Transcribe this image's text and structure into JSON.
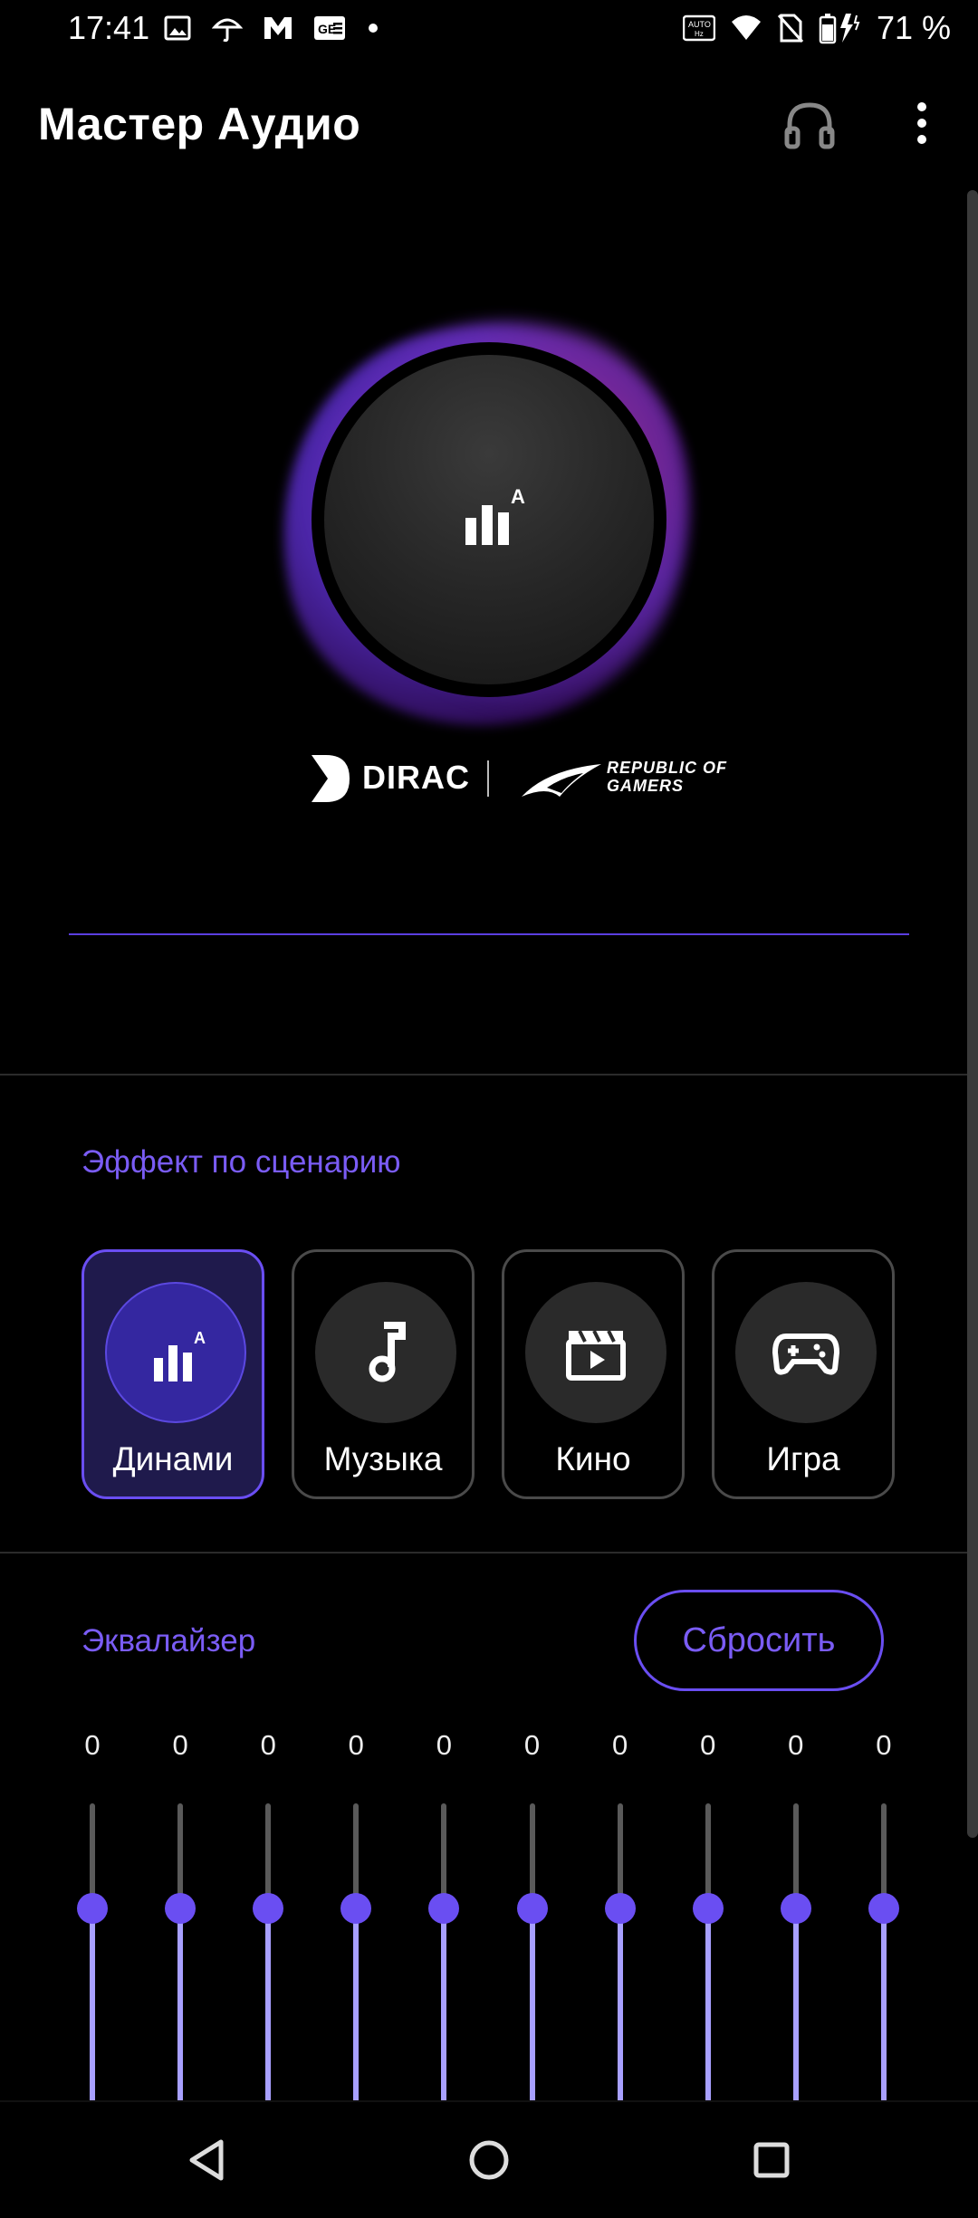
{
  "status_bar": {
    "time": "17:41",
    "battery": "71 %",
    "left_icons": [
      "image-icon",
      "umbrella-weather-icon",
      "m-app-icon",
      "news-icon",
      "dot-icon"
    ],
    "right_icons": [
      "auto-hz-icon",
      "wifi-icon",
      "no-sim-icon",
      "battery-charging-icon"
    ]
  },
  "app_bar": {
    "title": "Мастер Аудио",
    "icons": [
      "headphones-icon",
      "more-vert-icon"
    ]
  },
  "hero": {
    "icon": "equalizer-auto-icon",
    "accent_color": "#6a4ef2"
  },
  "brand": {
    "dirac": "DIRAC",
    "rog_line1": "REPUBLIC OF",
    "rog_line2": "GAMERS"
  },
  "scenario": {
    "label": "Эффект по сценарию",
    "selected": "Динами",
    "options": [
      {
        "label": "Динами",
        "icon": "equalizer-auto-icon"
      },
      {
        "label": "Музыка",
        "icon": "music-note-icon"
      },
      {
        "label": "Кино",
        "icon": "movie-clapper-icon"
      },
      {
        "label": "Игра",
        "icon": "gamepad-icon"
      }
    ]
  },
  "equalizer": {
    "label": "Эквалайзер",
    "reset_label": "Сбросить",
    "bands": [
      {
        "value": "0",
        "level": 0.5
      },
      {
        "value": "0",
        "level": 0.5
      },
      {
        "value": "0",
        "level": 0.5
      },
      {
        "value": "0",
        "level": 0.5
      },
      {
        "value": "0",
        "level": 0.5
      },
      {
        "value": "0",
        "level": 0.5
      },
      {
        "value": "0",
        "level": 0.5
      },
      {
        "value": "0",
        "level": 0.5
      },
      {
        "value": "0",
        "level": 0.5
      },
      {
        "value": "0",
        "level": 0.5
      }
    ]
  },
  "nav_bar": {
    "icons": [
      "back-icon",
      "home-icon",
      "recents-icon"
    ]
  },
  "colors": {
    "accent": "#6a4ef2",
    "accent_text": "#7a5cf5",
    "eq_fill": "#a8a0ff",
    "background": "#000000"
  }
}
